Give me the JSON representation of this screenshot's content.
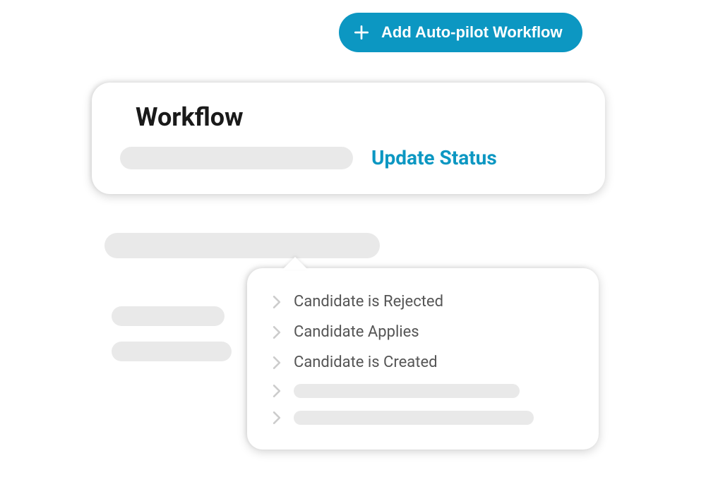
{
  "buttons": {
    "add_workflow": "Add Auto-pilot Workflow"
  },
  "workflow_card": {
    "title": "Workflow",
    "action": "Update Status"
  },
  "dropdown": {
    "items": [
      {
        "label": "Candidate is Rejected"
      },
      {
        "label": "Candidate Applies"
      },
      {
        "label": "Candidate is Created"
      }
    ]
  },
  "colors": {
    "accent": "#0C97C2",
    "skeleton": "#E9E9E9"
  }
}
